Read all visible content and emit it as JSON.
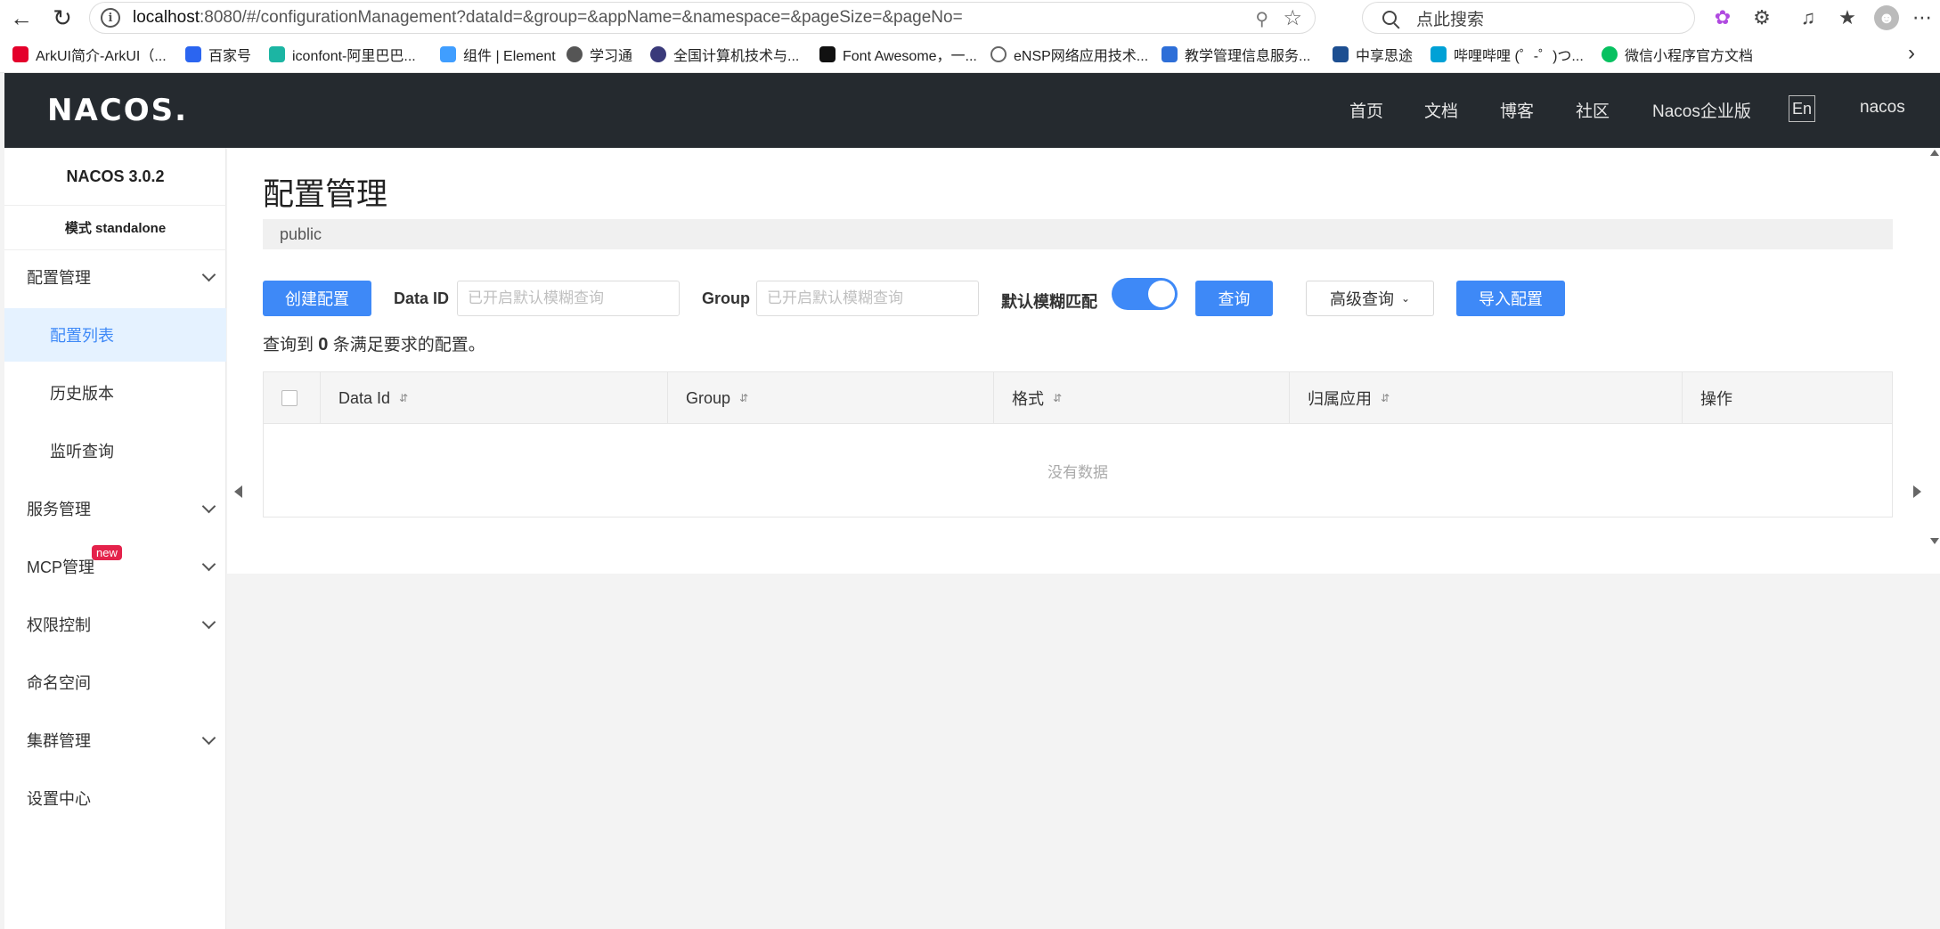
{
  "browser": {
    "url_host": "localhost",
    "url_rest": ":8080/#/configurationManagement?dataId=&group=&appName=&namespace=&pageSize=&pageNo=",
    "search_placeholder": "点此搜索"
  },
  "bookmarks": [
    {
      "label": "ArkUI简介-ArkUI（...",
      "color": "#e4002b"
    },
    {
      "label": "百家号",
      "color": "#2b65f0"
    },
    {
      "label": "iconfont-阿里巴巴...",
      "color": "#1cb5a3"
    },
    {
      "label": "组件 | Element",
      "color": "#409eff"
    },
    {
      "label": "学习通",
      "color": "#555555"
    },
    {
      "label": "全国计算机技术与...",
      "color": "#3a3a7a"
    },
    {
      "label": "Font Awesome，一...",
      "color": "#111111"
    },
    {
      "label": "eNSP网络应用技术...",
      "color": "#666666"
    },
    {
      "label": "教学管理信息服务...",
      "color": "#2e6fd8"
    },
    {
      "label": "中享思途",
      "color": "#1d4f91"
    },
    {
      "label": "哔哩哔哩 (゜-゜)つ...",
      "color": "#00a1d6"
    },
    {
      "label": "微信小程序官方文档",
      "color": "#07c160"
    }
  ],
  "topnav": {
    "logo": "NACOS.",
    "items": [
      "首页",
      "文档",
      "博客",
      "社区",
      "Nacos企业版"
    ],
    "lang": "En",
    "user": "nacos"
  },
  "sidebar": {
    "version": "NACOS 3.0.2",
    "mode": "模式 standalone",
    "menu": {
      "config": "配置管理",
      "config_list": "配置列表",
      "history": "历史版本",
      "listener": "监听查询",
      "service": "服务管理",
      "mcp": "MCP管理",
      "mcp_badge": "new",
      "auth": "权限控制",
      "namespace": "命名空间",
      "cluster": "集群管理",
      "settings": "设置中心"
    }
  },
  "main": {
    "title": "配置管理",
    "namespace": "public",
    "create_button": "创建配置",
    "dataid_label": "Data ID",
    "dataid_placeholder": "已开启默认模糊查询",
    "group_label": "Group",
    "group_placeholder": "已开启默认模糊查询",
    "fuzzy_label": "默认模糊匹配",
    "fuzzy_enabled": true,
    "query_button": "查询",
    "advanced_button": "高级查询",
    "import_button": "导入配置",
    "result_prefix": "查询到",
    "result_count": "0",
    "result_suffix": "条满足要求的配置。",
    "table": {
      "columns": [
        "Data Id",
        "Group",
        "格式",
        "归属应用",
        "操作"
      ],
      "empty": "没有数据"
    }
  },
  "colors": {
    "primary": "#3e89f7",
    "topnav_bg": "#252a2f",
    "active_menu_bg": "#e5f2ff",
    "badge_red": "#e4224b"
  }
}
